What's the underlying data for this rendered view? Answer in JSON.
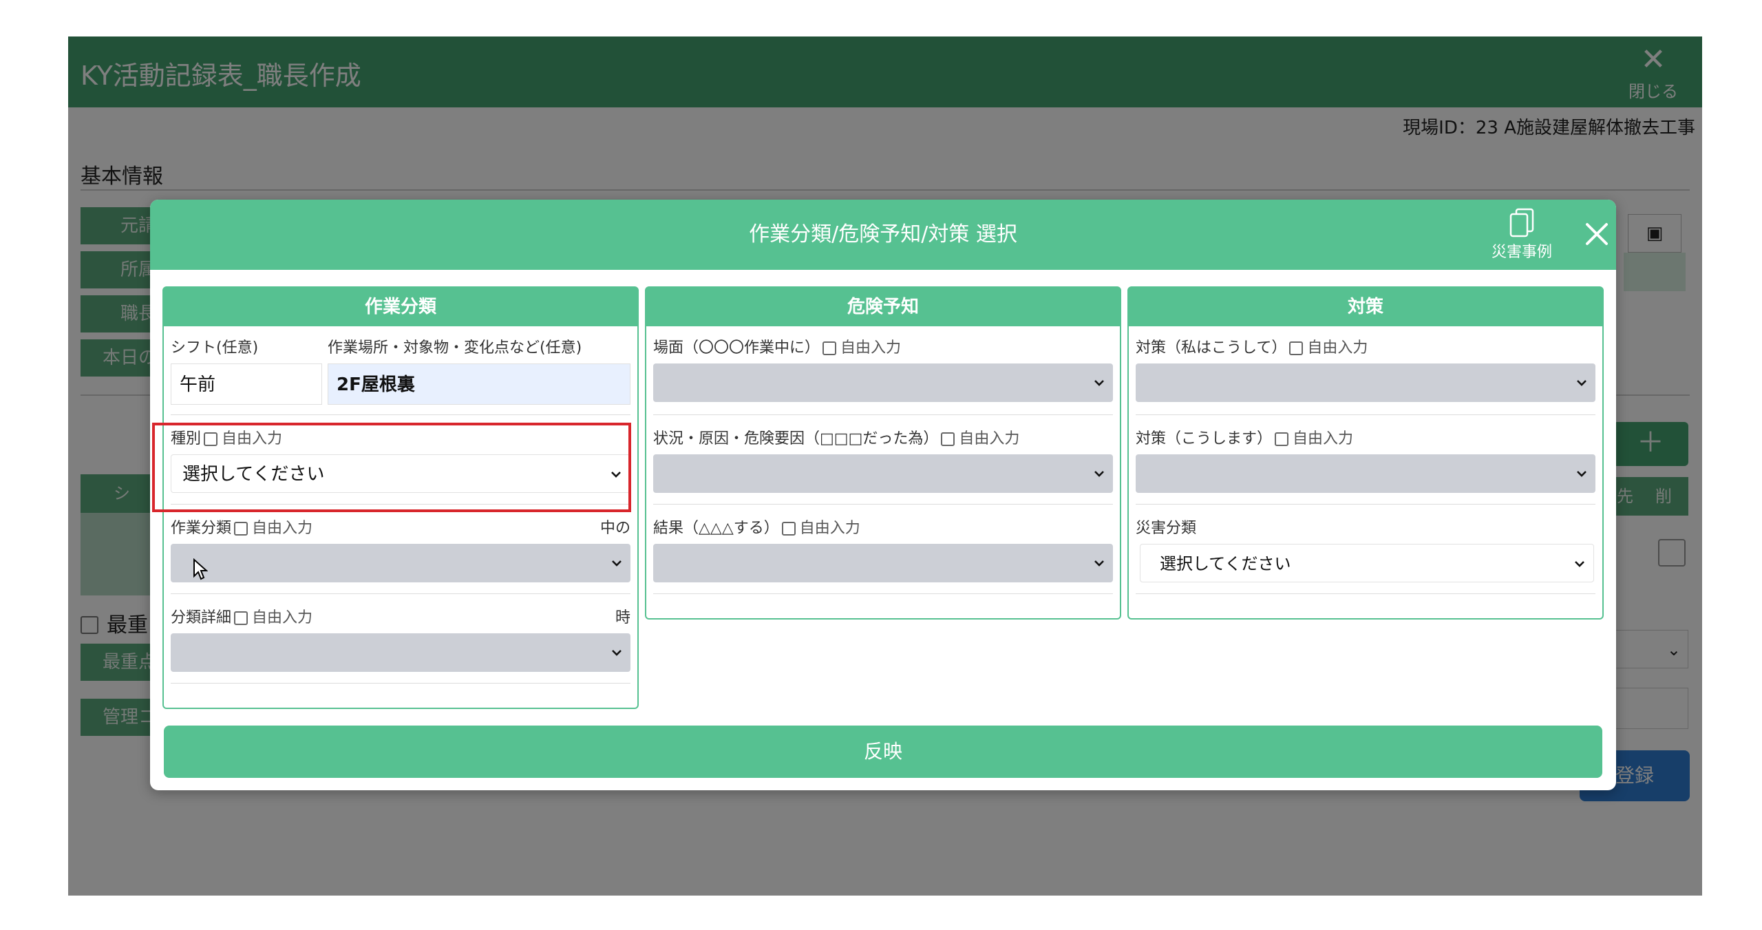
{
  "app": {
    "title": "KY活動記録表_職長作成",
    "close_label": "閉じる",
    "site_id": "現場ID：23 A施設建屋解体撤去工事",
    "section_title": "基本情報",
    "bg_labels": [
      "元請",
      "所属",
      "職長",
      "本日の"
    ],
    "bg_table_head": "シ",
    "bg_checkbox_label": "最重",
    "bg_row_labels": [
      "最重点",
      "管理コ"
    ],
    "bg_cols": [
      "先",
      "削"
    ],
    "register_label": "登録"
  },
  "modal": {
    "title": "作業分類/危険予知/対策 選択",
    "disaster_cases_label": "災害事例",
    "apply_label": "反映",
    "free_input_label": "自由入力",
    "panels": {
      "work": {
        "title": "作業分類",
        "shift_label": "シフト(任意)",
        "shift_value": "午前",
        "place_label": "作業場所・対象物・変化点など(任意)",
        "place_value": "2F屋根裏",
        "kind_label": "種別",
        "kind_value": "選択してください",
        "category_label": "作業分類",
        "category_hint": "中の",
        "detail_label": "分類詳細",
        "detail_hint": "時"
      },
      "hazard": {
        "title": "危険予知",
        "scene_label": "場面（〇〇〇作業中に）",
        "cause_label": "状況・原因・危険要因（□□□だった為）",
        "result_label": "結果（△△△する）"
      },
      "measures": {
        "title": "対策",
        "measure1_label": "対策（私はこうして）",
        "measure2_label": "対策（こうします）",
        "disaster_category_label": "災害分類",
        "disaster_category_value": "選択してください"
      }
    }
  },
  "colors": {
    "header_green": "#45a371",
    "modal_green": "#56c191",
    "highlight_red": "#d8262c",
    "register_blue": "#2f7dd3"
  }
}
